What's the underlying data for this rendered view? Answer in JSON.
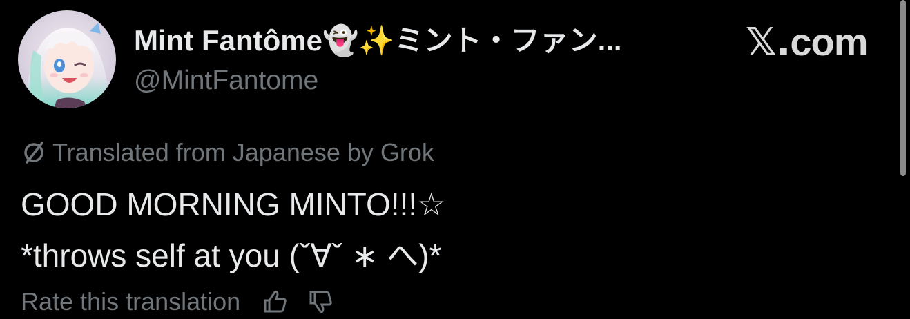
{
  "post": {
    "display_name": "Mint Fantôme👻✨ミント・ファン...",
    "handle": "@MintFantome",
    "brand": "com",
    "brand_prefix": "𝕏.",
    "translation_note": "Translated from Japanese by Grok",
    "text_line_1": "GOOD MORNING MINTO!!!☆",
    "text_line_2": "*throws self at you (ˇ∀ˇ ∗ へ)*",
    "rate_label": "Rate this translation"
  },
  "icons": {
    "avatar": "avatar-anime-girl",
    "translate": "translate-icon",
    "thumbs_up": "thumbs-up-icon",
    "thumbs_down": "thumbs-down-icon"
  },
  "colors": {
    "background": "#000000",
    "text_primary": "#e7e9ea",
    "text_secondary": "#71767b"
  }
}
